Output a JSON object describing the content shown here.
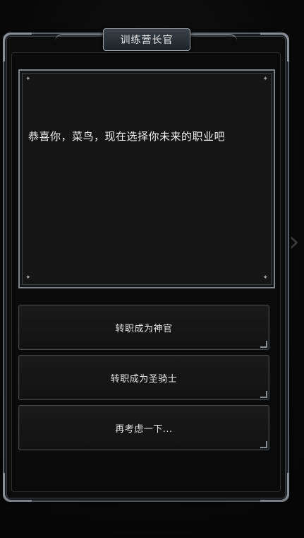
{
  "dialog": {
    "title": "训练营长官",
    "message": "恭喜你，菜鸟，现在选择你未来的职业吧",
    "options": [
      {
        "label": "转职成为神官"
      },
      {
        "label": "转职成为圣骑士"
      },
      {
        "label": "再考虑一下..."
      }
    ]
  },
  "icons": {
    "side_arrow": "chevron-right-icon",
    "corner_stars": "sparkle-icon"
  },
  "colors": {
    "frame": "#5c6268",
    "panel": "#151515",
    "text": "#f2f2f2"
  }
}
